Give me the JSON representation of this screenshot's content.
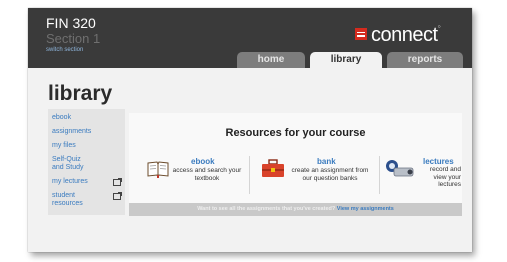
{
  "header": {
    "course_code": "FIN 320",
    "course_section": "Section 1",
    "switch_link": "switch section",
    "logo_text": "connect"
  },
  "tabs": [
    {
      "label": "home",
      "active": false
    },
    {
      "label": "library",
      "active": true
    },
    {
      "label": "reports",
      "active": false
    }
  ],
  "page": {
    "title": "library"
  },
  "sidebar": {
    "items": [
      {
        "label": "ebook",
        "external": false
      },
      {
        "label": "assignments",
        "external": false
      },
      {
        "label": "my files",
        "external": false
      },
      {
        "label": "Self-Quiz and Study",
        "external": false
      },
      {
        "label": "my lectures",
        "external": true
      },
      {
        "label": "student resources",
        "external": true
      }
    ]
  },
  "resources": {
    "title": "Resources for your course",
    "ebook": {
      "name": "ebook",
      "desc": "access and search your textbook",
      "icon": "open-book-icon"
    },
    "bank": {
      "name": "bank",
      "desc": "create an assignment from our question banks",
      "icon": "toolbox-icon"
    },
    "lectures": {
      "name": "lectures",
      "desc": "record and view your lectures",
      "icon": "projector-icon"
    }
  },
  "promo": {
    "text": "Want to see all the assignments that you've created?",
    "link": "View my assignments"
  },
  "colors": {
    "header_bg": "#3a3a3a",
    "link": "#3a7bbf",
    "brand_red": "#d52b1e"
  }
}
